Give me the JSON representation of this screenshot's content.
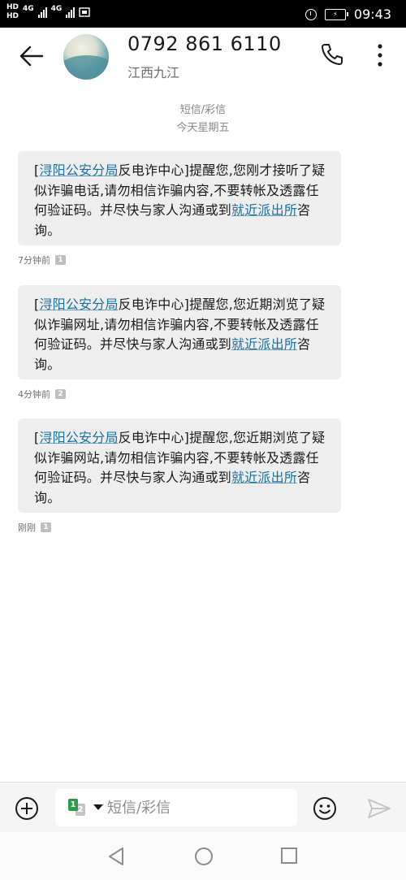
{
  "status_bar": {
    "hd_top": "HD",
    "hd_bottom": "HD",
    "network_1": "4G",
    "network_2": "4G",
    "time": "09:43",
    "icons": [
      "signal-icon",
      "wifi-icon",
      "alarm-icon",
      "battery-icon"
    ]
  },
  "header": {
    "title": "0792 861 6110",
    "subtitle": "江西九江",
    "icons": [
      "back-arrow-icon",
      "phone-icon",
      "more-vertical-icon"
    ]
  },
  "date_header": {
    "type": "短信/彩信",
    "day": "今天星期五"
  },
  "messages": [
    {
      "prefix": "[",
      "link_1": "浔阳公安分局",
      "text_1": "反电诈中心]提醒您,您刚才接听了疑似诈骗电话,请勿相信诈骗内容,不要转帐及透露任何验证码。并尽快与家人沟通或到",
      "link_2": "就近派出所",
      "text_2": "咨询。",
      "time": "7分钟前",
      "sim": "1"
    },
    {
      "prefix": "[",
      "link_1": "浔阳公安分局",
      "text_1": "反电诈中心]提醒您,您近期浏览了疑似诈骗网址,请勿相信诈骗内容,不要转帐及透露任何验证码。并尽快与家人沟通或到",
      "link_2": "就近派出所",
      "text_2": "咨询。",
      "time": "4分钟前",
      "sim": "2"
    },
    {
      "prefix": "[",
      "link_1": "浔阳公安分局",
      "text_1": "反电诈中心]提醒您,您近期浏览了疑似诈骗网站,请勿相信诈骗内容,不要转帐及透露任何验证码。并尽快与家人沟通或到",
      "link_2": "就近派出所",
      "text_2": "咨询。",
      "time": "刚刚",
      "sim": "1"
    }
  ],
  "composer": {
    "placeholder": "短信/彩信",
    "sim_primary": "1",
    "sim_secondary": "2",
    "icons": [
      "add-icon",
      "emoji-icon",
      "send-icon"
    ]
  },
  "colors": {
    "link": "#1a6f9c",
    "bubble": "#eeeeee",
    "sim_active": "#2e9b45"
  }
}
